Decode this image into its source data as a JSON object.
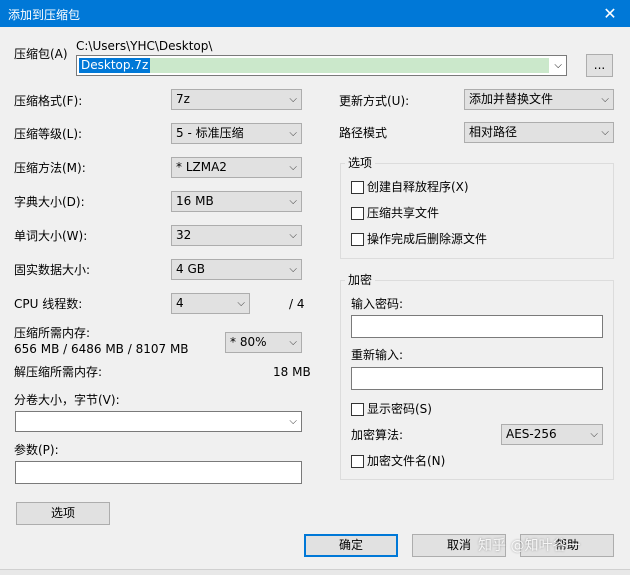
{
  "window": {
    "title": "添加到压缩包",
    "close_glyph": "✕"
  },
  "archive": {
    "label": "压缩包(A)",
    "path": "C:\\Users\\YHC\\Desktop\\",
    "name": "Desktop.7z",
    "browse_label": "..."
  },
  "left": {
    "format_label": "压缩格式(F):",
    "format_value": "7z",
    "level_label": "压缩等级(L):",
    "level_value": "5 - 标准压缩",
    "method_label": "压缩方法(M):",
    "method_value": "* LZMA2",
    "dict_label": "字典大小(D):",
    "dict_value": "16 MB",
    "word_label": "单词大小(W):",
    "word_value": "32",
    "solid_label": "固实数据大小:",
    "solid_value": "4 GB",
    "cpu_label": "CPU 线程数:",
    "cpu_value": "4",
    "cpu_total": "/ 4",
    "mem_label": "压缩所需内存:",
    "mem_values": "656 MB / 6486 MB / 8107 MB",
    "mem_percent": "* 80%",
    "demem_label": "解压缩所需内存:",
    "demem_value": "18 MB",
    "split_label": "分卷大小，字节(V):",
    "split_value": "",
    "params_label": "参数(P):",
    "params_value": "",
    "options_button": "选项"
  },
  "right": {
    "update_label": "更新方式(U):",
    "update_value": "添加并替换文件",
    "pathmode_label": "路径模式",
    "pathmode_value": "相对路径",
    "options_group": "选项",
    "opt_sfx": "创建自释放程序(X)",
    "opt_shared": "压缩共享文件",
    "opt_delete": "操作完成后删除源文件",
    "encrypt_group": "加密",
    "password_label": "输入密码:",
    "password_value": "",
    "reenter_label": "重新输入:",
    "reenter_value": "",
    "show_password": "显示密码(S)",
    "method_label": "加密算法:",
    "method_value": "AES-256",
    "encrypt_names": "加密文件名(N)"
  },
  "buttons": {
    "ok": "确定",
    "cancel": "取消",
    "help": "帮助"
  },
  "watermark": "知乎 @知叶谷一"
}
